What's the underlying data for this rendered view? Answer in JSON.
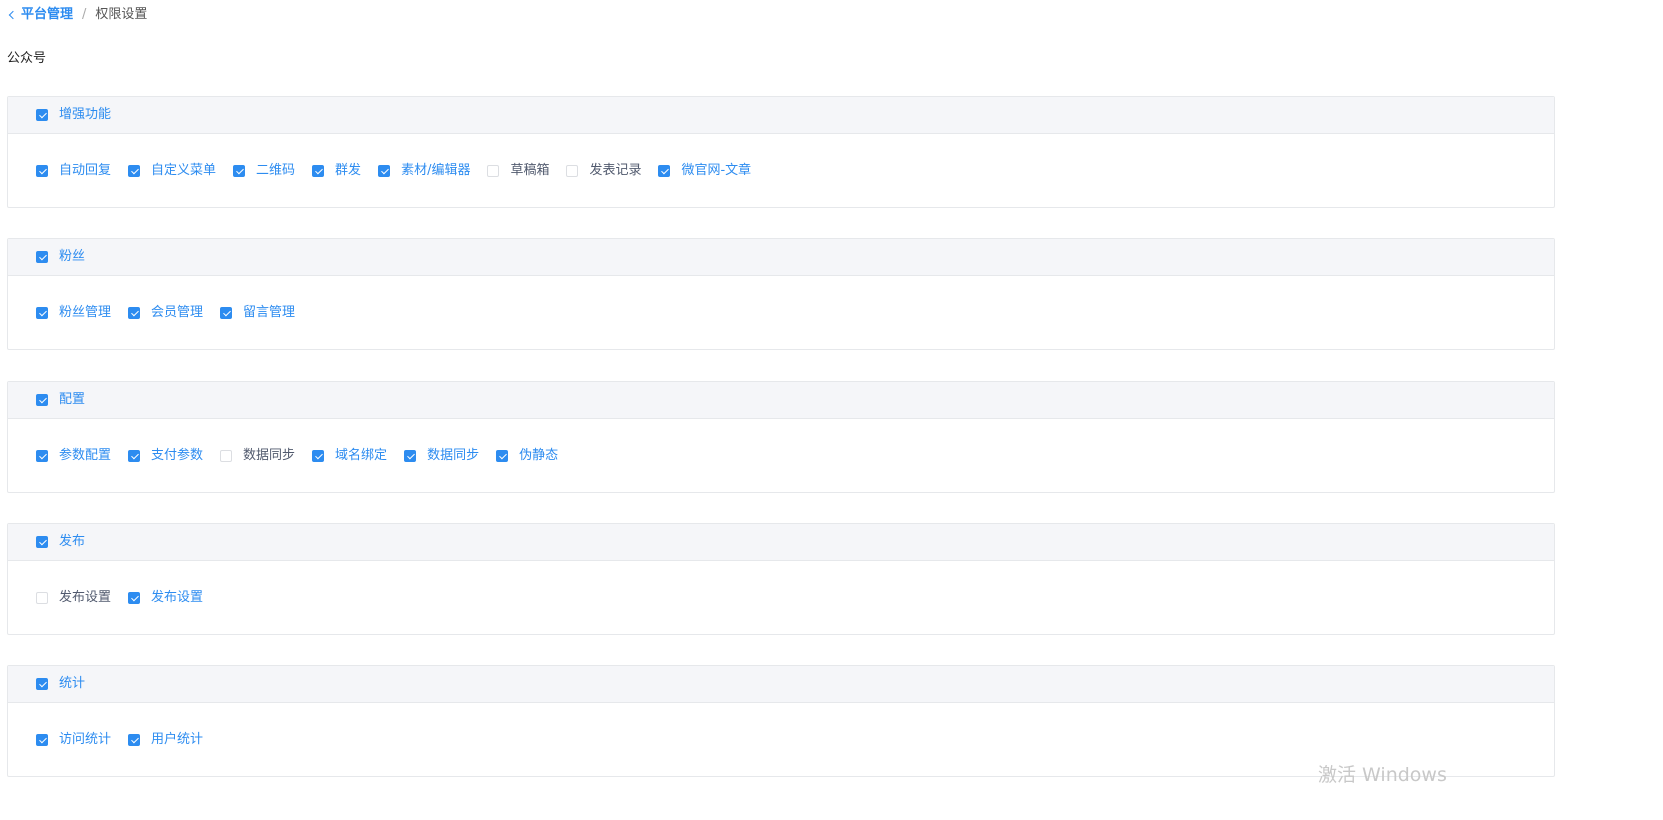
{
  "breadcrumb": {
    "parent": "平台管理",
    "separator": "/",
    "current": "权限设置"
  },
  "page_title": "公众号",
  "groups": [
    {
      "title": "增强功能",
      "checked": true,
      "items": [
        {
          "label": "自动回复",
          "checked": true
        },
        {
          "label": "自定义菜单",
          "checked": true
        },
        {
          "label": "二维码",
          "checked": true
        },
        {
          "label": "群发",
          "checked": true
        },
        {
          "label": "素材/编辑器",
          "checked": true
        },
        {
          "label": "草稿箱",
          "checked": false
        },
        {
          "label": "发表记录",
          "checked": false
        },
        {
          "label": "微官网-文章",
          "checked": true
        }
      ]
    },
    {
      "title": "粉丝",
      "checked": true,
      "items": [
        {
          "label": "粉丝管理",
          "checked": true
        },
        {
          "label": "会员管理",
          "checked": true
        },
        {
          "label": "留言管理",
          "checked": true
        }
      ]
    },
    {
      "title": "配置",
      "checked": true,
      "items": [
        {
          "label": "参数配置",
          "checked": true
        },
        {
          "label": "支付参数",
          "checked": true
        },
        {
          "label": "数据同步",
          "checked": false
        },
        {
          "label": "域名绑定",
          "checked": true
        },
        {
          "label": "数据同步",
          "checked": true
        },
        {
          "label": "伪静态",
          "checked": true
        }
      ]
    },
    {
      "title": "发布",
      "checked": true,
      "items": [
        {
          "label": "发布设置",
          "checked": false
        },
        {
          "label": "发布设置",
          "checked": true
        }
      ]
    },
    {
      "title": "统计",
      "checked": true,
      "items": [
        {
          "label": "访问统计",
          "checked": true
        },
        {
          "label": "用户统计",
          "checked": true
        }
      ]
    }
  ],
  "watermark": "激活 Windows",
  "colors": {
    "accent": "#2d8cf0",
    "header_bg": "#f5f6f9",
    "border": "#e6e8eb",
    "unchecked_text": "#515a6e"
  }
}
